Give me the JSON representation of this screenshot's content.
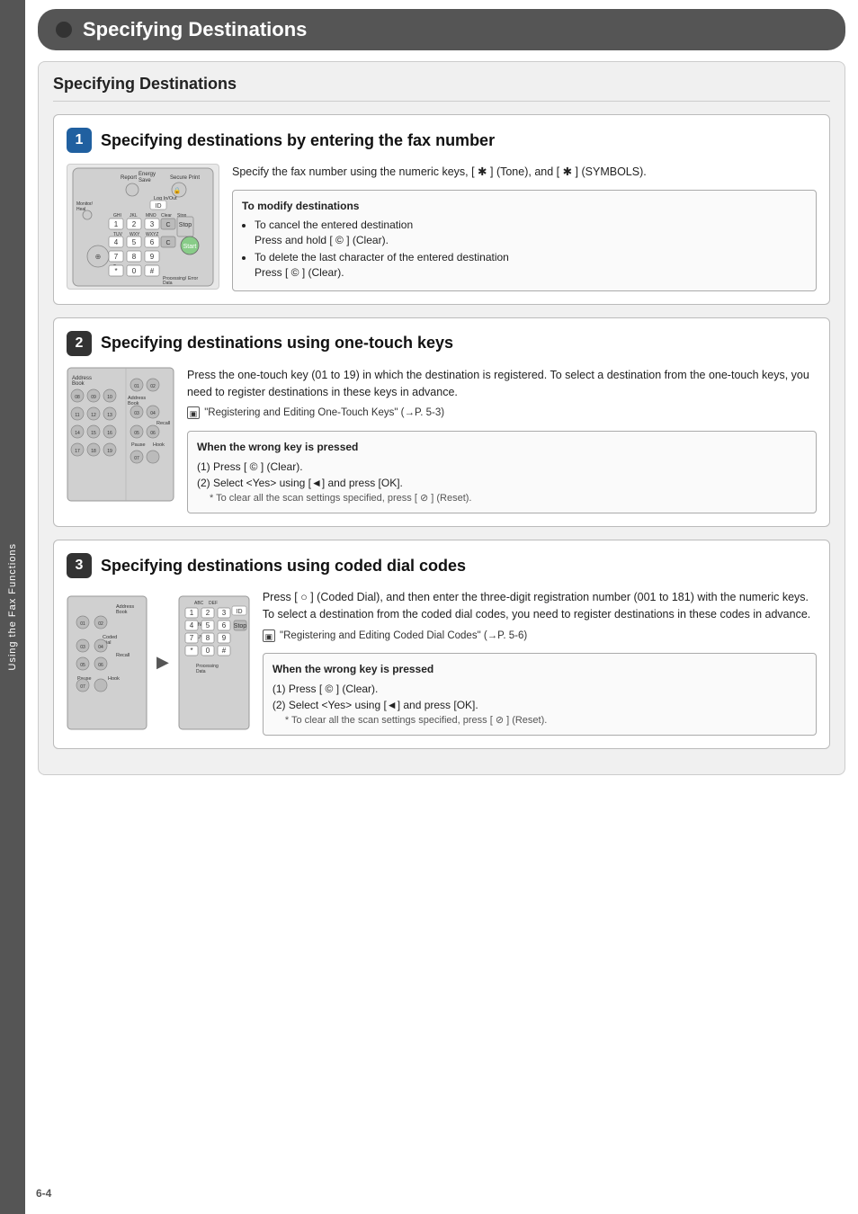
{
  "sidebar": {
    "label": "Using the Fax Functions"
  },
  "page_header": {
    "title": "Specifying Destinations",
    "bullet": "●"
  },
  "content_title": "Specifying Destinations",
  "sections": [
    {
      "number": "1",
      "title": "Specifying destinations by entering the fax number",
      "body": "Specify the fax number using the numeric keys, [ ✱ ] (Tone), and [ ✱ ] (SYMBOLS).",
      "info_box": {
        "title": "To modify destinations",
        "items": [
          "To cancel the entered destination\nPress and hold [ © ] (Clear).",
          "To delete the last character of the entered destination\nPress [ © ] (Clear)."
        ]
      }
    },
    {
      "number": "2",
      "title": "Specifying destinations using one-touch keys",
      "body": "Press the one-touch key (01 to 19) in which the destination is registered. To select a destination from the one-touch keys, you need to register destinations in these keys in advance.",
      "ref": "\"Registering and Editing One-Touch Keys\" (→P. 5-3)",
      "warn_box": {
        "title": "When the wrong key is pressed",
        "lines": [
          "(1) Press [ © ] (Clear).",
          "(2) Select <Yes> using [◄] and press [OK].",
          "* To clear all the scan settings specified, press [ ⊘ ] (Reset)."
        ]
      }
    },
    {
      "number": "3",
      "title": "Specifying destinations using coded dial codes",
      "body": "Press [ ○ ] (Coded Dial), and then enter the three-digit registration number (001 to 181) with the numeric keys.\nTo select a destination from the coded dial codes, you need to register destinations in these codes in advance.",
      "ref": "\"Registering and Editing Coded Dial Codes\" (→P. 5-6)",
      "warn_box": {
        "title": "When the wrong key is pressed",
        "lines": [
          "(1) Press [ © ] (Clear).",
          "(2) Select <Yes> using [◄] and press [OK].",
          "* To clear all the scan settings specified, press [ ⊘ ] (Reset)."
        ]
      }
    }
  ],
  "page_number": "6-4"
}
